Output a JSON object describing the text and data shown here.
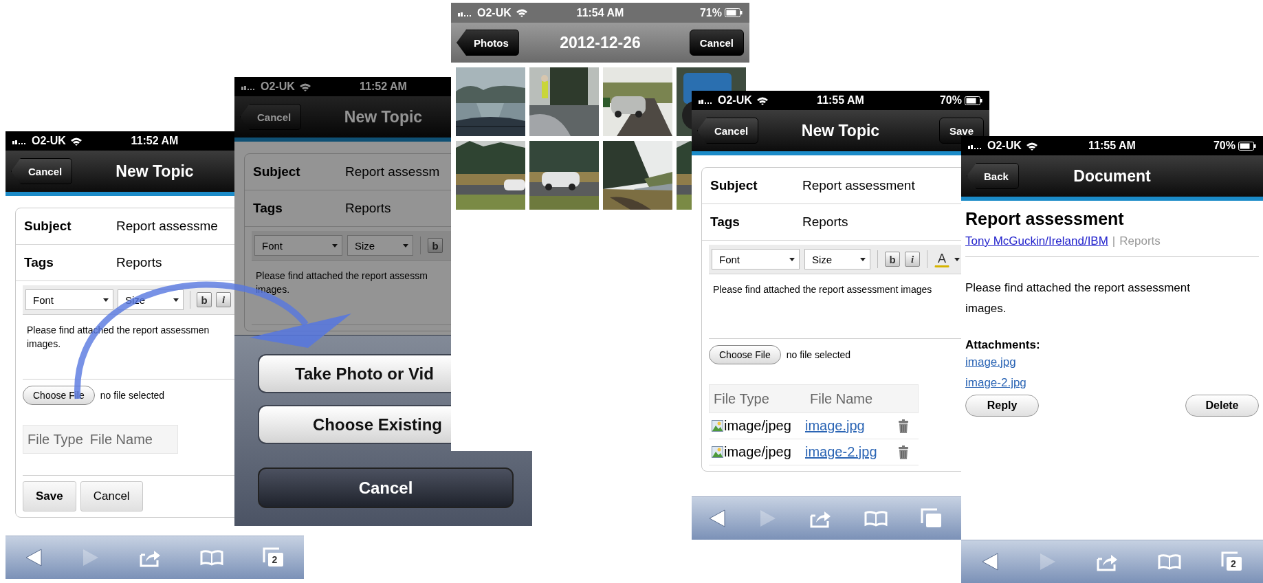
{
  "screens": [
    {
      "kind": "new_topic",
      "status": {
        "carrier": "O2-UK",
        "time": "11:52 AM"
      },
      "nav": {
        "back": "Cancel",
        "title": "New Topic"
      },
      "form": {
        "fields": [
          {
            "label": "Subject",
            "value": "Report assessme"
          },
          {
            "label": "Tags",
            "value": "Reports"
          }
        ],
        "font": "Font",
        "size": "Size",
        "format_buttons": [
          {
            "kind": "bold",
            "glyph": "b"
          },
          {
            "kind": "italic",
            "glyph": "i"
          }
        ],
        "body": "Please find attached the report assessmen\nimages.",
        "choose_file": "Choose File",
        "file_status": "no file selected",
        "file_columns": [
          "File Type",
          "File Name"
        ],
        "buttons": [
          "Save",
          "Cancel"
        ]
      },
      "browser_toolbar": {
        "forward_disabled": true,
        "tabs_count": "2"
      }
    },
    {
      "kind": "new_topic",
      "dimmed": true,
      "status": {
        "carrier": "O2-UK",
        "time": "11:52 AM"
      },
      "nav": {
        "back": "Cancel",
        "title": "New Topic"
      },
      "form": {
        "fields": [
          {
            "label": "Subject",
            "value": "Report assessm"
          },
          {
            "label": "Tags",
            "value": "Reports"
          }
        ],
        "font": "Font",
        "size": "Size",
        "format_buttons": [
          {
            "kind": "bold",
            "glyph": "b"
          }
        ],
        "body": "Please find attached the report assessm\nimages."
      },
      "action_sheet": {
        "options": [
          "Take Photo or Vid",
          "Choose Existing"
        ],
        "cancel": "Cancel"
      }
    },
    {
      "kind": "photo_picker",
      "status": {
        "carrier": "O2-UK",
        "time": "11:54 AM",
        "battery": "71%"
      },
      "nav": {
        "back": "Photos",
        "title": "2012-12-26",
        "action": "Cancel"
      }
    },
    {
      "kind": "new_topic",
      "status": {
        "carrier": "O2-UK",
        "time": "11:55 AM",
        "battery": "70%"
      },
      "nav": {
        "back": "Cancel",
        "title": "New Topic",
        "action": "Save"
      },
      "form": {
        "fields": [
          {
            "label": "Subject",
            "value": "Report assessment"
          },
          {
            "label": "Tags",
            "value": "Reports"
          }
        ],
        "font": "Font",
        "size": "Size",
        "format_buttons": [
          {
            "kind": "bold",
            "glyph": "b"
          },
          {
            "kind": "italic",
            "glyph": "i"
          },
          {
            "kind": "color",
            "glyph": "A"
          }
        ],
        "body": "Please find attached the report assessment images",
        "choose_file": "Choose File",
        "file_status": "no file selected",
        "file_columns": [
          "File Type",
          "File Name"
        ],
        "files": [
          {
            "type": "image/jpeg",
            "name": "image.jpg"
          },
          {
            "type": "image/jpeg",
            "name": "image-2.jpg"
          }
        ]
      },
      "browser_toolbar": {
        "forward_disabled": true
      }
    },
    {
      "kind": "document",
      "status": {
        "carrier": "O2-UK",
        "time": "11:55 AM",
        "battery": "70%"
      },
      "nav": {
        "back": "Back",
        "title": "Document"
      },
      "document": {
        "title": "Report assessment",
        "author": "Tony McGuckin/Ireland/IBM",
        "separator": "|",
        "tags": "Reports",
        "body": "Please find attached the report assessment images.",
        "attachments_label": "Attachments:",
        "attachments": [
          "image.jpg",
          "image-2.jpg"
        ],
        "buttons": [
          "Reply",
          "Delete"
        ]
      },
      "browser_toolbar": {
        "forward_disabled": true,
        "tabs_count": "2"
      }
    }
  ]
}
